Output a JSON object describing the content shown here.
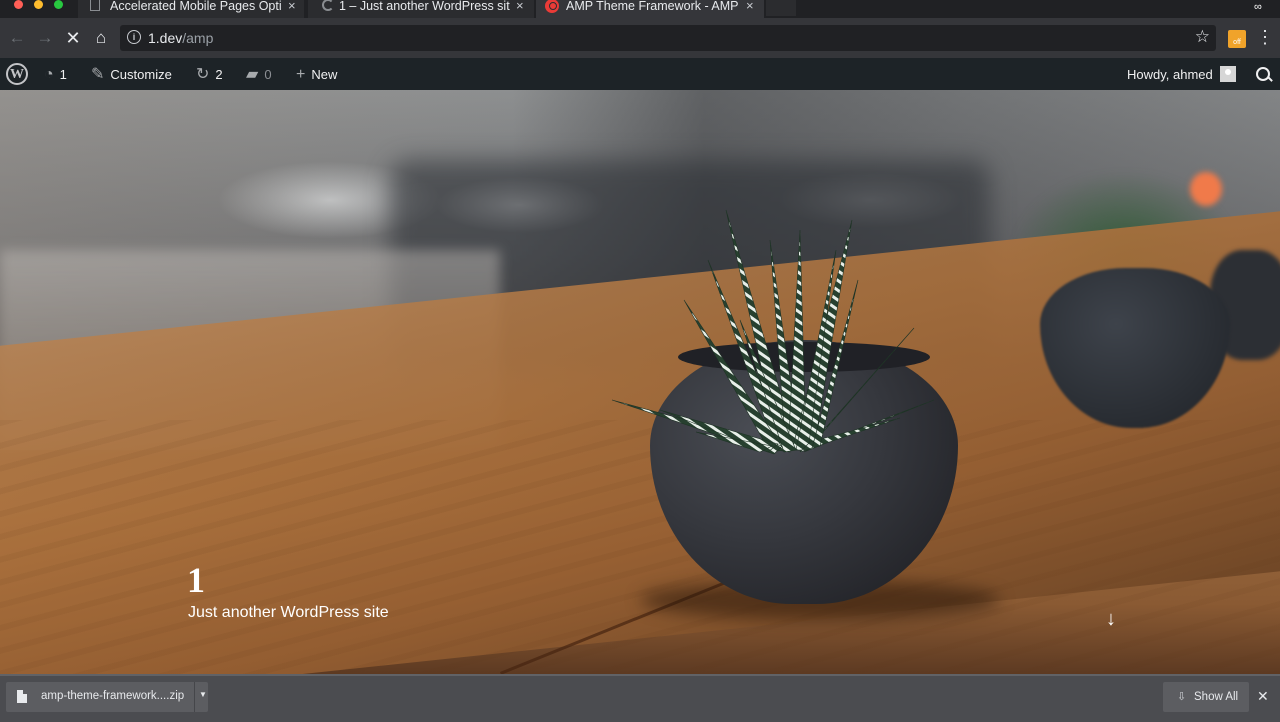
{
  "browser": {
    "tabs": [
      {
        "title": "Accelerated Mobile Pages Opti",
        "active": false
      },
      {
        "title": "1 – Just another WordPress sit",
        "active": false
      },
      {
        "title": "AMP Theme Framework - AMP",
        "active": true
      }
    ],
    "tab_close_glyph": "×",
    "address": {
      "host": "1.dev",
      "path": "/amp"
    },
    "extension_badge": "off"
  },
  "admin_bar": {
    "updates_count": "1",
    "customize_label": "Customize",
    "revisions_count": "2",
    "comments_count": "0",
    "new_label": "New",
    "greeting": "Howdy, ahmed"
  },
  "hero": {
    "site_title": "1",
    "tagline": "Just another WordPress site"
  },
  "downloads": {
    "file_name": "amp-theme-framework....zip",
    "show_all_label": "Show All"
  },
  "colors": {
    "admin_bar_bg": "#1d2327",
    "toolbar_bg": "#35363a",
    "download_bar_bg": "#4b4c50",
    "amp_favicon": "#ea3b37"
  }
}
